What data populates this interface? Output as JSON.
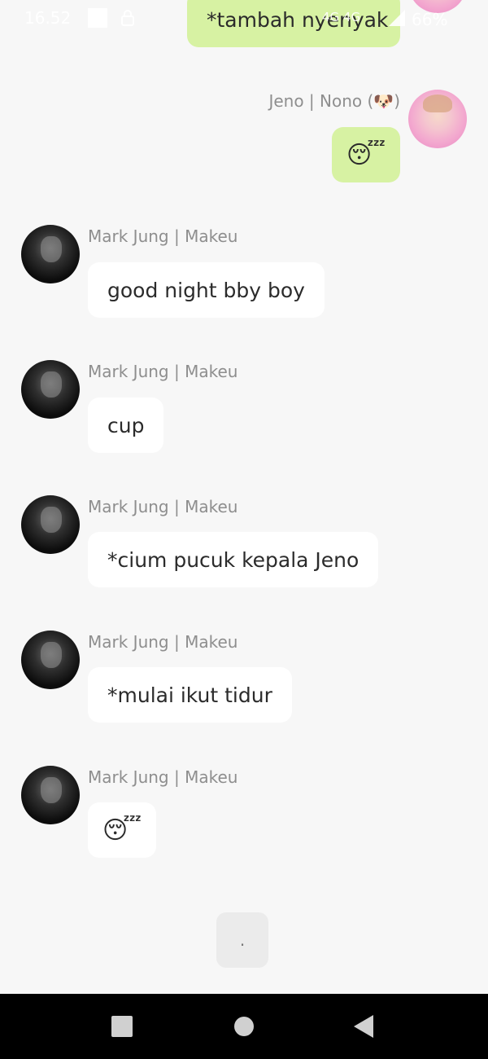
{
  "status_bar": {
    "time": "16.52",
    "network": "4G 4G",
    "battery": "66%"
  },
  "messages": [
    {
      "id": "m0",
      "from": "me",
      "text": "*tambah  nyenyak"
    },
    {
      "id": "m1",
      "from": "me",
      "sender": "Jeno | Nono (🐶)",
      "text": "😴",
      "is_emoji": true
    },
    {
      "id": "m2",
      "from": "other",
      "sender": "Mark Jung | Makeu",
      "text": "good night bby boy"
    },
    {
      "id": "m3",
      "from": "other",
      "sender": "Mark Jung | Makeu",
      "text": "cup"
    },
    {
      "id": "m4",
      "from": "other",
      "sender": "Mark Jung | Makeu",
      "text": "*cium pucuk kepala Jeno"
    },
    {
      "id": "m5",
      "from": "other",
      "sender": "Mark Jung | Makeu",
      "text": "*mulai ikut tidur"
    },
    {
      "id": "m6",
      "from": "other",
      "sender": "Mark Jung | Makeu",
      "text": "😴",
      "is_emoji": true
    }
  ],
  "typing_indicator": ".",
  "colors": {
    "background": "#f7f7f7",
    "my_bubble": "#d7f2a3",
    "their_bubble": "#ffffff",
    "sender_text": "#8e8e8e",
    "navbar": "#000000"
  },
  "icons": {
    "nav_recent": "square-icon",
    "nav_home": "circle-icon",
    "nav_back": "triangle-back-icon"
  }
}
